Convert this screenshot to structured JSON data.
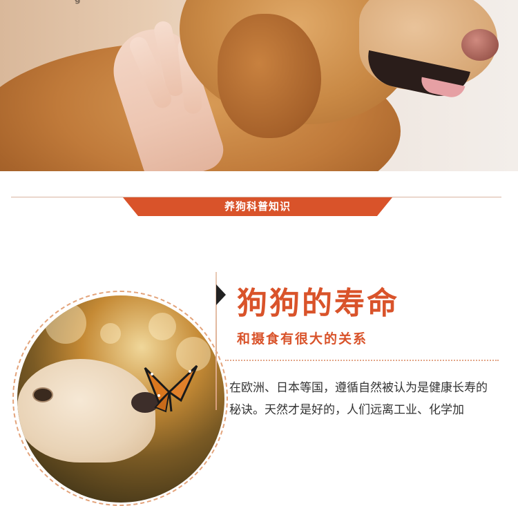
{
  "hero": {
    "logo_fragment": "g"
  },
  "section_banner": {
    "label": "养狗科普知识",
    "color": "#d9532a"
  },
  "article": {
    "title": "狗狗的寿命",
    "subtitle": "和摄食有很大的关系",
    "body_lines": [
      "在欧洲、日本等国，遵循自然被认为是健康长寿的",
      "秘诀。天然才是好的，人们远离工业、化学加"
    ],
    "accent_color": "#d9532a"
  }
}
